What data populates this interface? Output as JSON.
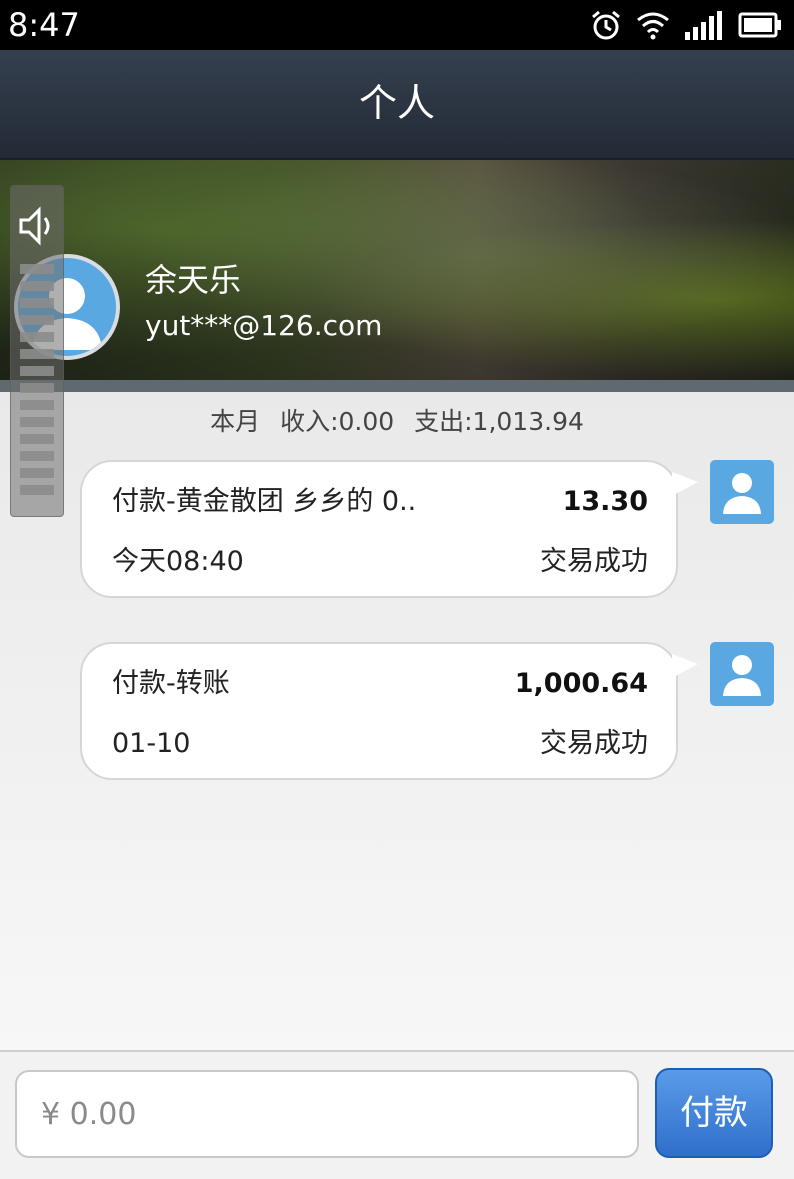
{
  "status_bar": {
    "time": "8:47"
  },
  "header": {
    "title": "个人"
  },
  "profile": {
    "name": "余天乐",
    "email": "yut***@126.com"
  },
  "summary": {
    "period": "本月",
    "income": "收入:0.00",
    "expense": "支出:1,013.94"
  },
  "transactions": [
    {
      "description": "付款-黄金散团 乡乡的 0..",
      "amount": "13.30",
      "date": "今天08:40",
      "status": "交易成功"
    },
    {
      "description": "付款-转账",
      "amount": "1,000.64",
      "date": "01-10",
      "status": "交易成功"
    }
  ],
  "payment": {
    "placeholder": "¥ 0.00",
    "button_label": "付款"
  },
  "icons": {
    "alarm": "alarm-icon",
    "wifi": "wifi-icon",
    "signal": "signal-icon",
    "battery": "battery-icon",
    "speaker": "speaker-icon",
    "avatar": "user-avatar-icon"
  },
  "colors": {
    "header": "#2c3542",
    "accent": "#5aa8e2",
    "pay_button": "#3b7fd6"
  }
}
